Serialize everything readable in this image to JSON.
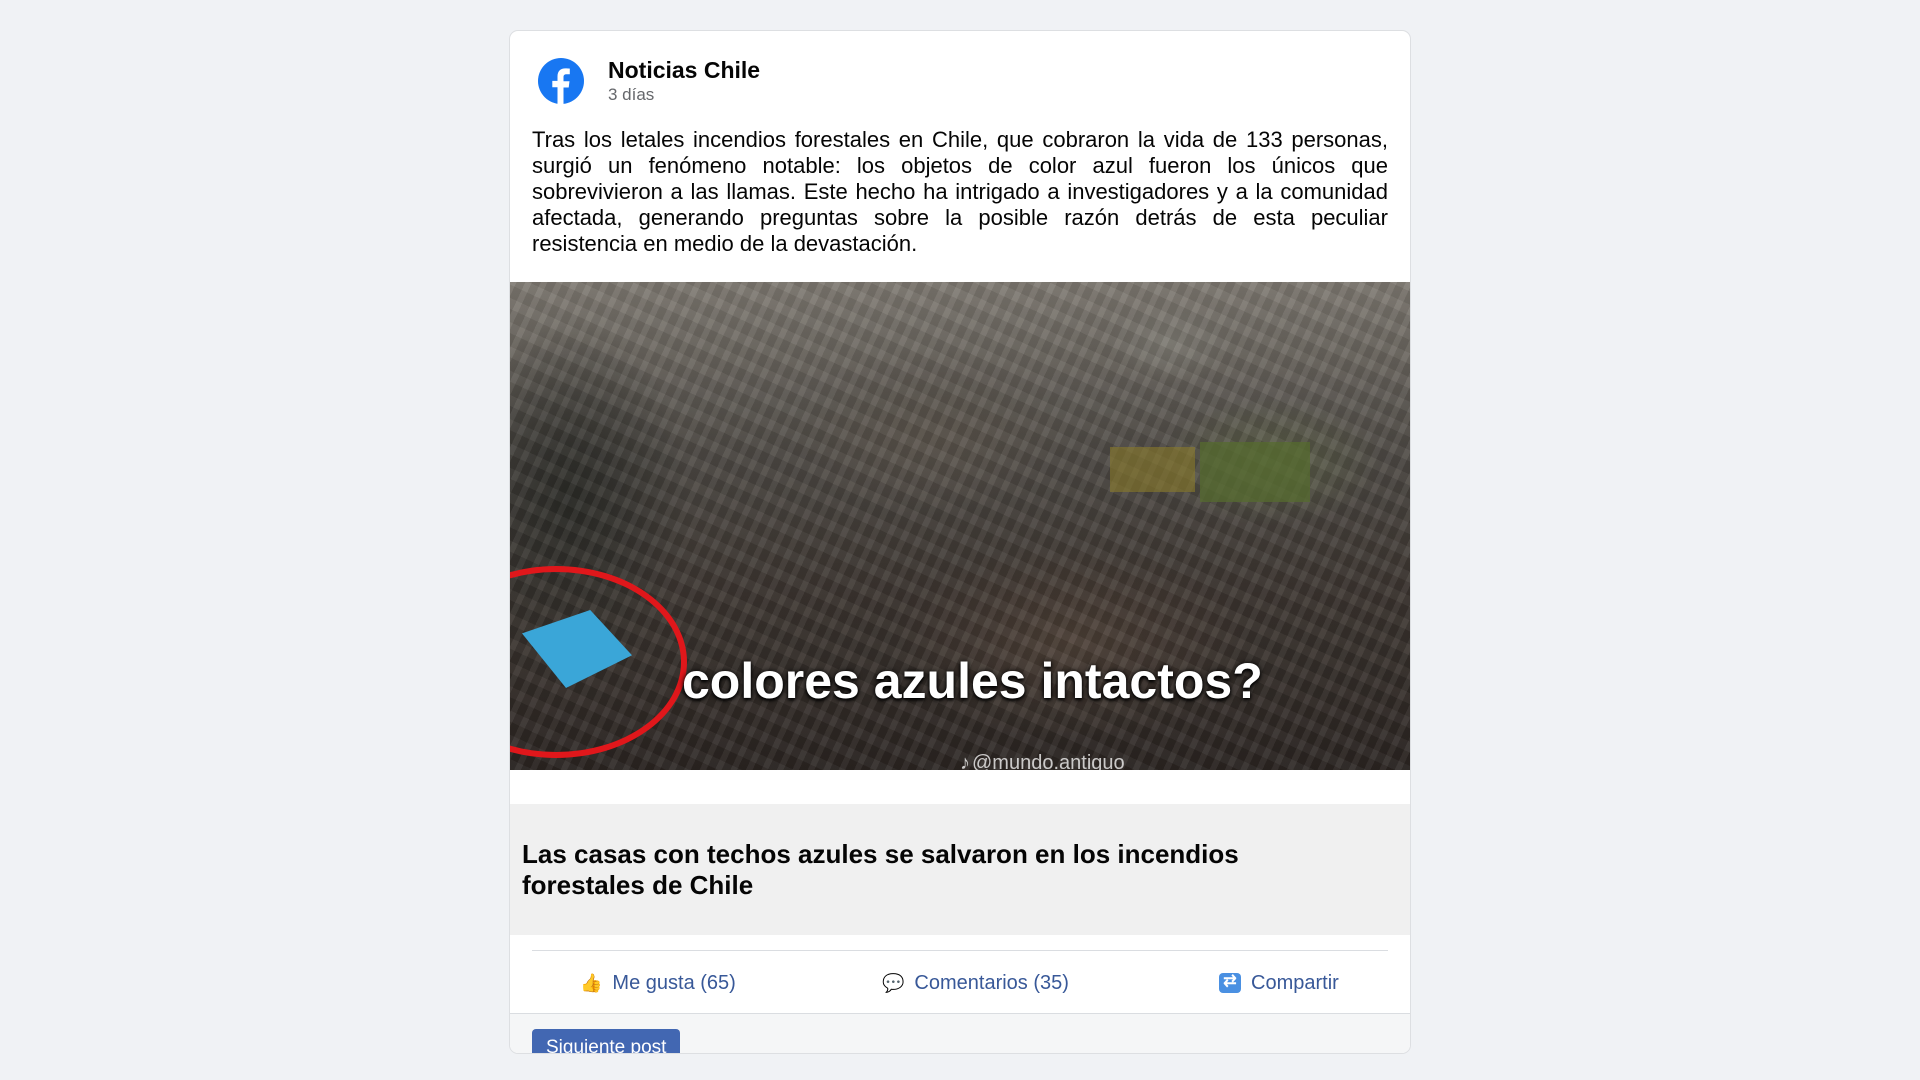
{
  "post": {
    "page_name": "Noticias Chile",
    "time": "3 días",
    "text": "Tras los letales incendios forestales en Chile, que cobraron la vida de 133 personas, surgió un fenómeno notable: los objetos de color azul fueron los únicos que sobrevivieron a las llamas. Este hecho ha intrigado a investigadores y a la comunidad afectada, generando preguntas sobre la posible razón detrás de esta peculiar resistencia en medio de la devastación.",
    "image": {
      "overlay_text": "colores azules intactos?",
      "watermark": "@mundo.antiguo"
    },
    "link_title": "Las casas con techos azules se salvaron en los incendios forestales de Chile"
  },
  "actions": {
    "like_label": "Me gusta (65)",
    "comment_label": "Comentarios (35)",
    "share_label": "Compartir"
  },
  "footer": {
    "next_label": "Siguiente post"
  },
  "icons": {
    "logo": "facebook-logo-icon",
    "like": "thumbs-up-icon",
    "comment": "speech-bubble-icon",
    "share": "share-arrows-icon"
  },
  "colors": {
    "brand": "#1877f2",
    "action_text": "#385898",
    "button": "#4267b2",
    "highlight_circle": "#e0171b",
    "blue_roof": "#3aa6d8"
  }
}
